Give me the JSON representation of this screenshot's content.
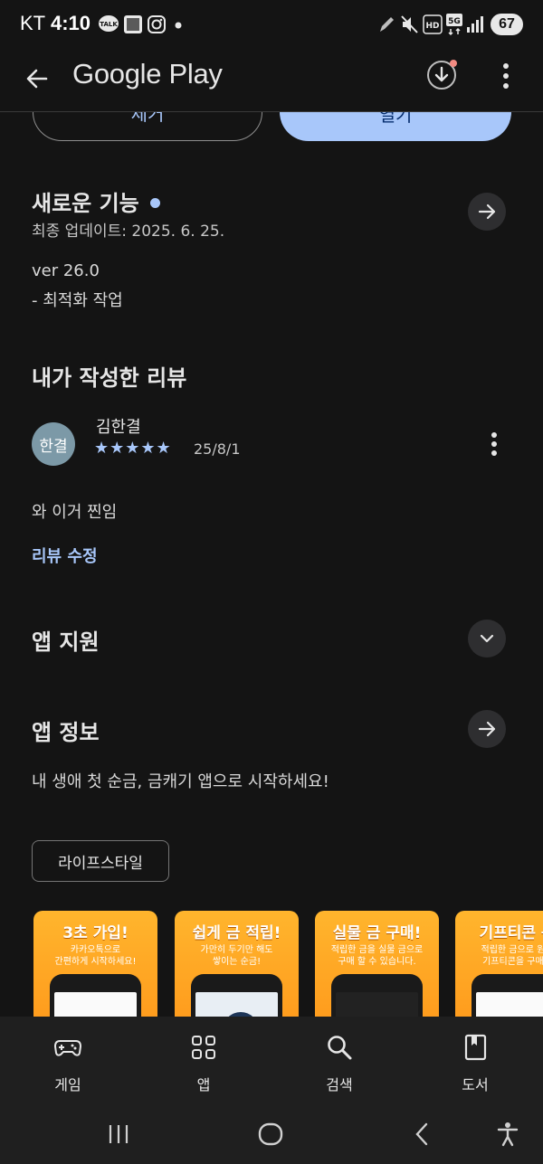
{
  "status_bar": {
    "carrier": "KT",
    "time": "4:10",
    "battery": "67",
    "talk_badge": "TALK",
    "hd_label": "HD",
    "network_label": "5G"
  },
  "app_bar": {
    "title": "Google Play"
  },
  "actions": {
    "remove_label": "제거",
    "open_label": "열기"
  },
  "whats_new": {
    "title": "새로운 기능",
    "updated": "최종 업데이트: 2025. 6. 25.",
    "version": "ver 26.0",
    "note": "- 최적화 작업"
  },
  "my_review": {
    "title": "내가 작성한 리뷰",
    "avatar_text": "한결",
    "reviewer": "김한결",
    "rating": 5,
    "stars": "★★★★★",
    "date": "25/8/1",
    "text": "와 이거 찐임",
    "edit_label": "리뷰 수정"
  },
  "app_support": {
    "title": "앱 지원"
  },
  "app_info": {
    "title": "앱 정보",
    "description": "내 생애 첫 순금, 금캐기 앱으로 시작하세요!",
    "category_chip": "라이프스타일"
  },
  "screenshots": [
    {
      "title": "3초 가입!",
      "sub1": "카카오톡으로",
      "sub2": "간편하게 시작하세요!"
    },
    {
      "title": "쉽게 금 적립!",
      "sub1": "가만히 두기만 해도",
      "sub2": "쌓이는 순금!"
    },
    {
      "title": "실물 금 구매!",
      "sub1": "적립한 금을 실물 금으로",
      "sub2": "구매 할 수 있습니다."
    },
    {
      "title": "기프티콘 구",
      "sub1": "적립한 금으로 원하",
      "sub2": "기프티콘을 구매하"
    }
  ],
  "bottom_nav": {
    "items": [
      {
        "label": "게임",
        "icon": "gamepad-icon"
      },
      {
        "label": "앱",
        "icon": "apps-grid-icon"
      },
      {
        "label": "검색",
        "icon": "search-icon"
      },
      {
        "label": "도서",
        "icon": "book-icon"
      }
    ]
  },
  "colors": {
    "background": "#141414",
    "accent": "#a8c7fa",
    "screenshot_orange": "#ffa726"
  }
}
